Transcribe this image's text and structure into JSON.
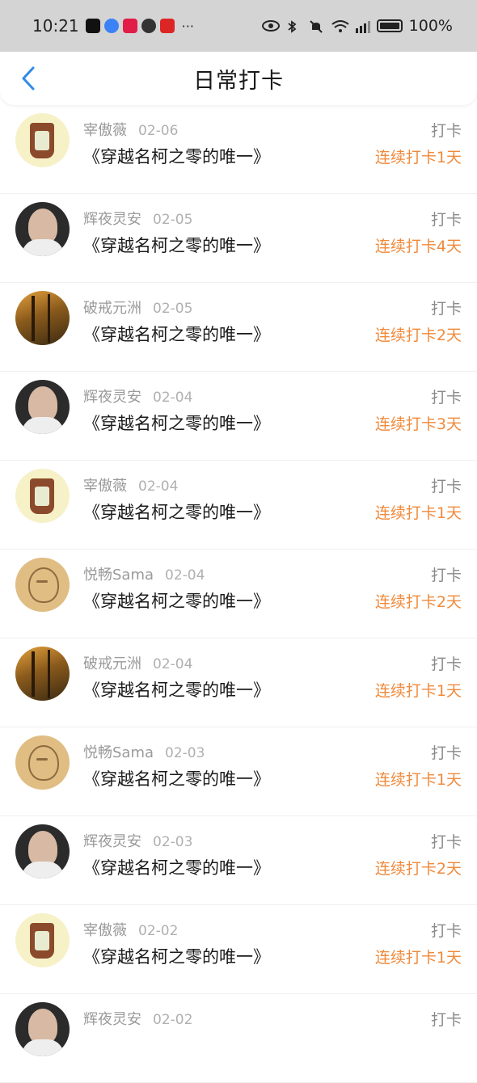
{
  "status": {
    "time": "10:21",
    "battery": "100%",
    "network": "4G",
    "app_icons": [
      "tiktok-icon",
      "browser-icon",
      "app-icon",
      "chat-icon",
      "red-app-icon"
    ]
  },
  "header": {
    "title": "日常打卡",
    "back_icon": "chevron-left-icon",
    "accent": "#2f8be8"
  },
  "colors": {
    "streak": "#f08a3c",
    "muted": "#9a9a9a",
    "text": "#1a1a1a"
  },
  "items": [
    {
      "user": "宰傲薇",
      "avatar": "weiwei",
      "date": "02-06",
      "book": "《穿越名柯之零的唯一》",
      "type": "打卡",
      "streak": "连续打卡1天"
    },
    {
      "user": "辉夜灵安",
      "avatar": "huiye",
      "date": "02-05",
      "book": "《穿越名柯之零的唯一》",
      "type": "打卡",
      "streak": "连续打卡4天"
    },
    {
      "user": "破戒元洲",
      "avatar": "pojie",
      "date": "02-05",
      "book": "《穿越名柯之零的唯一》",
      "type": "打卡",
      "streak": "连续打卡2天"
    },
    {
      "user": "辉夜灵安",
      "avatar": "huiye",
      "date": "02-04",
      "book": "《穿越名柯之零的唯一》",
      "type": "打卡",
      "streak": "连续打卡3天"
    },
    {
      "user": "宰傲薇",
      "avatar": "weiwei",
      "date": "02-04",
      "book": "《穿越名柯之零的唯一》",
      "type": "打卡",
      "streak": "连续打卡1天"
    },
    {
      "user": "悦畅Sama",
      "avatar": "yuechang",
      "date": "02-04",
      "book": "《穿越名柯之零的唯一》",
      "type": "打卡",
      "streak": "连续打卡2天"
    },
    {
      "user": "破戒元洲",
      "avatar": "pojie",
      "date": "02-04",
      "book": "《穿越名柯之零的唯一》",
      "type": "打卡",
      "streak": "连续打卡1天"
    },
    {
      "user": "悦畅Sama",
      "avatar": "yuechang",
      "date": "02-03",
      "book": "《穿越名柯之零的唯一》",
      "type": "打卡",
      "streak": "连续打卡1天"
    },
    {
      "user": "辉夜灵安",
      "avatar": "huiye",
      "date": "02-03",
      "book": "《穿越名柯之零的唯一》",
      "type": "打卡",
      "streak": "连续打卡2天"
    },
    {
      "user": "宰傲薇",
      "avatar": "weiwei",
      "date": "02-02",
      "book": "《穿越名柯之零的唯一》",
      "type": "打卡",
      "streak": "连续打卡1天"
    },
    {
      "user": "辉夜灵安",
      "avatar": "huiye",
      "date": "02-02",
      "book": "",
      "type": "打卡",
      "streak": ""
    }
  ]
}
